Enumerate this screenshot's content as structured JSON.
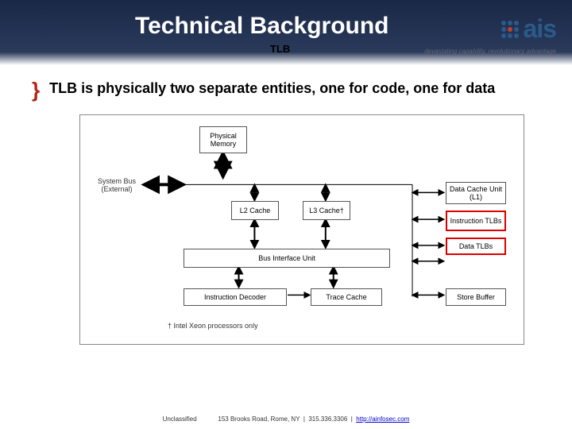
{
  "header": {
    "title": "Technical Background",
    "subtitle": "TLB",
    "logo_text": "ais",
    "tagline": "devastating capability, revolutionary advantage"
  },
  "bullet": {
    "text": "TLB is physically two separate entities, one for code, one for data"
  },
  "diagram": {
    "boxes": {
      "phys_mem": "Physical\nMemory",
      "sys_bus": "System Bus\n(External)",
      "l2": "L2 Cache",
      "l3": "L3 Cache†",
      "dcu": "Data Cache\nUnit (L1)",
      "itlb": "Instruction\nTLBs",
      "dtlb": "Data TLBs",
      "bus_if": "Bus Interface Unit",
      "instr_dec": "Instruction Decoder",
      "trace": "Trace Cache",
      "store_buf": "Store Buffer"
    },
    "footnote": "† Intel Xeon processors only"
  },
  "footer": {
    "classification": "Unclassified",
    "address": "153 Brooks Road, Rome, NY",
    "phone": "315.336.3306",
    "link_text": "http://ainfosec.com"
  }
}
